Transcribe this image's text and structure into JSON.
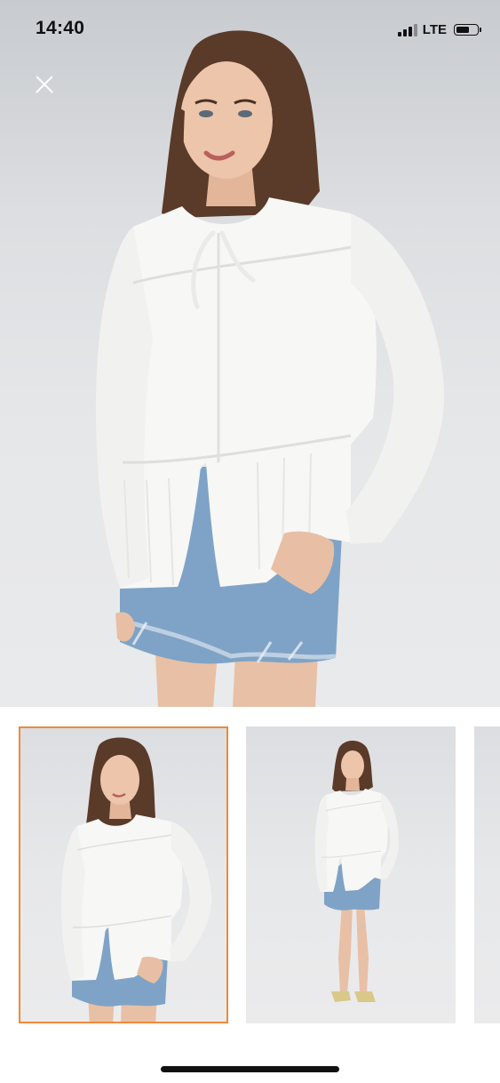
{
  "status_bar": {
    "time": "14:40",
    "network": "LTE",
    "signal_bars_active": 3,
    "signal_bars_total": 4,
    "battery_level_pct": 55
  },
  "gallery": {
    "close_icon": "close-icon",
    "thumbnails": [
      {
        "id": "front-closeup",
        "selected": true
      },
      {
        "id": "full-body",
        "selected": false
      },
      {
        "id": "partial-next",
        "selected": false
      }
    ],
    "selected_border_color": "#ee8a3c"
  },
  "colors": {
    "blouse": "#f7f7f6",
    "denim": "#7fa3c6",
    "hair": "#5a3a28",
    "skin": "#e8bfa4",
    "background": "#e6e7e9"
  }
}
